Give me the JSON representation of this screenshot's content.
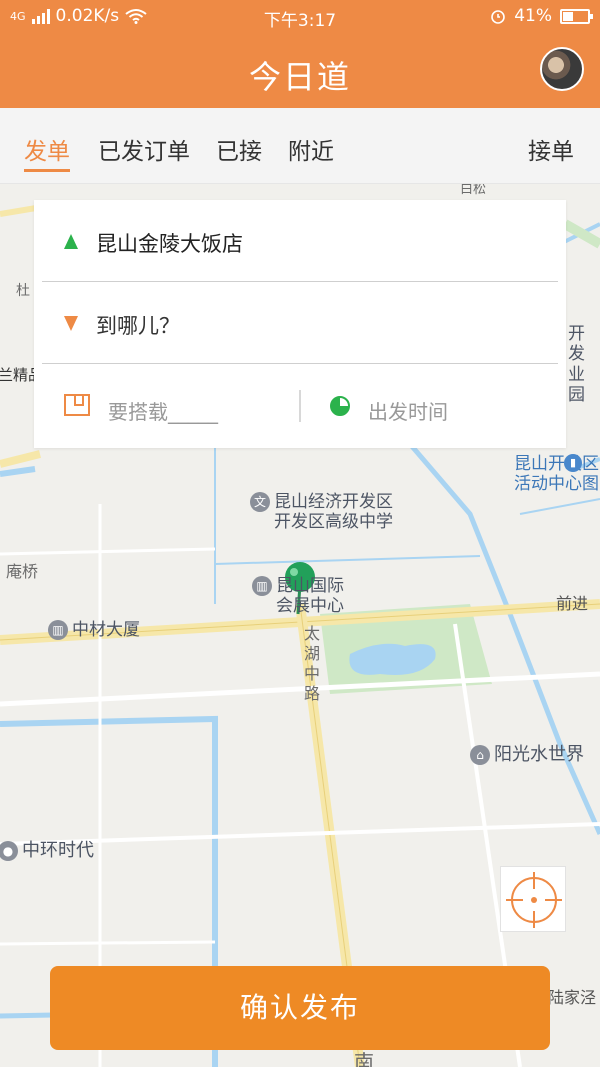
{
  "status_bar": {
    "network": "4G",
    "speed": "0.02K/s",
    "time": "下午3:17",
    "battery": "41%",
    "battery_level": 0.41
  },
  "header": {
    "title": "今日道"
  },
  "tabs": [
    {
      "label": "发单",
      "active": true
    },
    {
      "label": "已发订单",
      "active": false
    },
    {
      "label": "已接",
      "active": false
    },
    {
      "label": "附近",
      "active": false
    }
  ],
  "accept_tab": {
    "label": "接单"
  },
  "form": {
    "origin": "昆山金陵大饭店",
    "destination_placeholder": "到哪儿？",
    "load_placeholder": "要搭载_____",
    "departure_placeholder": "出发时间"
  },
  "map": {
    "pois": {
      "kunshan_dev_zone_school": "昆山经济开发区\n开发区高级中学",
      "convention_center": "昆山国际\n会展中心",
      "zhongcai_building": "中材大厦",
      "sunshine_water_world": "阳光水世界",
      "zhonghuan_times": "中环时代",
      "activity_center": "昆山开发区\n活动中心图",
      "dev_zone_partial": "开发\n业园"
    },
    "road_labels": {
      "taihu_road": "太湖中路",
      "qianjin_road": "前进",
      "pangqiao": "庵桥",
      "lu_jia": "陆家泾",
      "baisong": "白松",
      "du": "杜",
      "lan_jing": "兰精品",
      "nan": "南"
    }
  },
  "confirm_button": {
    "label": "确认发布"
  },
  "colors": {
    "brand": "#ee8a45",
    "origin_marker": "#2bb24c",
    "destination_marker": "#ee8a45"
  }
}
